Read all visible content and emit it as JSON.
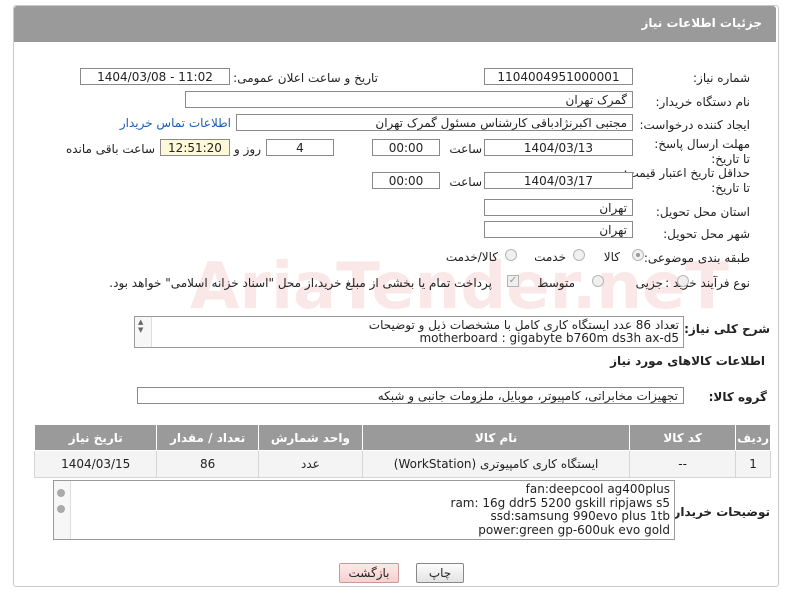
{
  "header": {
    "title": "جزئیات اطلاعات نیاز"
  },
  "fields": {
    "need_number": {
      "label": "شماره نیاز:",
      "value": "1104004951000001"
    },
    "announce_datetime": {
      "label": "تاریخ و ساعت اعلان عمومی:",
      "value": "1404/03/08 - 11:02"
    },
    "buyer_org": {
      "label": "نام دستگاه خریدار:",
      "value": "گمرک تهران"
    },
    "requester": {
      "label": "ایجاد کننده درخواست:",
      "value": "مجتبی اکبرنژادباقی کارشناس مسئول گمرک تهران",
      "link": "اطلاعات تماس خریدار"
    },
    "reply_deadline": {
      "label": "مهلت ارسال پاسخ: تا تاریخ:",
      "date": "1404/03/13",
      "time_label": "ساعت",
      "time": "00:00",
      "days": "4",
      "days_label": "روز و",
      "remaining": "12:51:20",
      "remaining_label": "ساعت باقی مانده"
    },
    "price_validity": {
      "label": "حداقل تاریخ اعتبار قیمت: تا تاریخ:",
      "date": "1404/03/17",
      "time_label": "ساعت",
      "time": "00:00"
    },
    "delivery_province": {
      "label": "استان محل تحویل:",
      "value": "تهران"
    },
    "delivery_city": {
      "label": "شهر محل تحویل:",
      "value": "تهران"
    },
    "category": {
      "label": "طبقه بندی موضوعی:",
      "options": [
        "کالا",
        "خدمت",
        "کالا/خدمت"
      ]
    },
    "purchase_process": {
      "label": "نوع فرآیند خرید :",
      "options": [
        "جزیی",
        "متوسط"
      ],
      "payment_note": "پرداخت تمام یا بخشی از مبلغ خرید،از محل \"اسناد خزانه اسلامی\" خواهد بود."
    }
  },
  "summary": {
    "label": "شرح کلی نیاز:",
    "lines": [
      "تعداد 86 عدد ایستگاه کاری کامل با مشخصات ذیل و توضیحات",
      "motherboard : gigabyte b760m ds3h ax-d5"
    ]
  },
  "goods_section": {
    "title": "اطلاعات کالاهای مورد نیاز"
  },
  "goods_group": {
    "label": "گروه کالا:",
    "value": "تجهیزات مخابراتی، کامپیوتر، موبایل، ملزومات جانبی و شبکه"
  },
  "table": {
    "headers": [
      "ردیف",
      "کد کالا",
      "نام کالا",
      "واحد شمارش",
      "تعداد / مقدار",
      "تاریخ نیاز"
    ],
    "rows": [
      [
        "1",
        "--",
        "ایستگاه کاری کامپیوتری (WorkStation)",
        "عدد",
        "86",
        "1404/03/15"
      ]
    ]
  },
  "buyer_notes": {
    "label": "توضیحات خریدار:",
    "lines": [
      "fan:deepcool ag400plus",
      "ram: 16g ddr5 5200 gskill ripjaws s5",
      "ssd:samsung 990evo plus 1tb",
      "power:green gp-600uk evo gold"
    ]
  },
  "buttons": {
    "print": "چاپ",
    "back": "بازگشت"
  },
  "watermark": {
    "text": "AriaTender.neT"
  }
}
